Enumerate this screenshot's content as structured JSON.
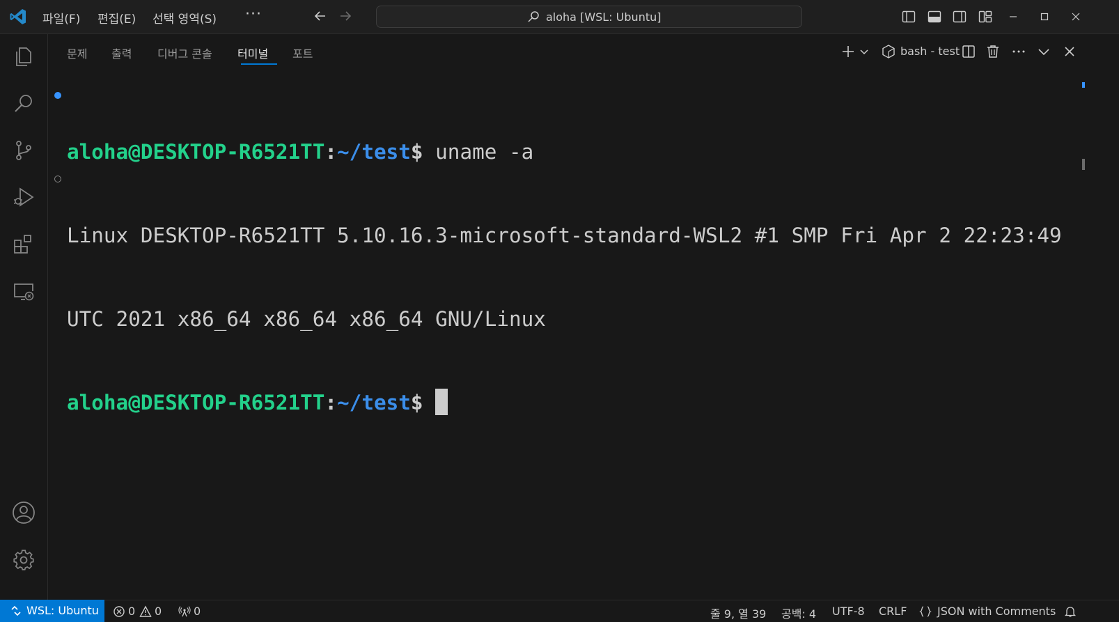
{
  "menu": {
    "file": "파일(F)",
    "edit": "편집(E)",
    "selection": "선택 영역(S)",
    "more": "···"
  },
  "command_center": {
    "title": "aloha [WSL: Ubuntu]",
    "icon": "search-icon"
  },
  "activity_bar": {
    "items": [
      "explorer-icon",
      "search-icon",
      "source-control-icon",
      "run-debug-icon",
      "extensions-icon",
      "remote-explorer-icon"
    ],
    "bottom": [
      "account-icon",
      "manage-gear-icon"
    ]
  },
  "panel": {
    "tabs": [
      {
        "label": "문제",
        "active": false
      },
      {
        "label": "출력",
        "active": false
      },
      {
        "label": "디버그 콘솔",
        "active": false
      },
      {
        "label": "터미널",
        "active": true
      },
      {
        "label": "포트",
        "active": false
      }
    ],
    "terminal_name": "bash - test"
  },
  "terminal": {
    "prompt_user": "aloha@DESKTOP-R6521TT",
    "prompt_colon": ":",
    "prompt_path": "~/test",
    "prompt_dollar": "$",
    "command": " uname -a",
    "output_line1": "Linux DESKTOP-R6521TT 5.10.16.3-microsoft-standard-WSL2 #1 SMP Fri Apr 2 22:23:49",
    "output_line2": "UTC 2021 x86_64 x86_64 x86_64 GNU/Linux"
  },
  "statusbar": {
    "remote": "WSL: Ubuntu",
    "errors": "0",
    "warnings": "0",
    "ports": "0",
    "cursor_position": "줄 9, 열 39",
    "indent": "공백: 4",
    "encoding": "UTF-8",
    "eol": "CRLF",
    "language": "JSON with Comments"
  },
  "colors": {
    "accent": "#0078d4",
    "prompt_user": "#23d18b",
    "prompt_path": "#3b8eea",
    "background": "#181818"
  }
}
